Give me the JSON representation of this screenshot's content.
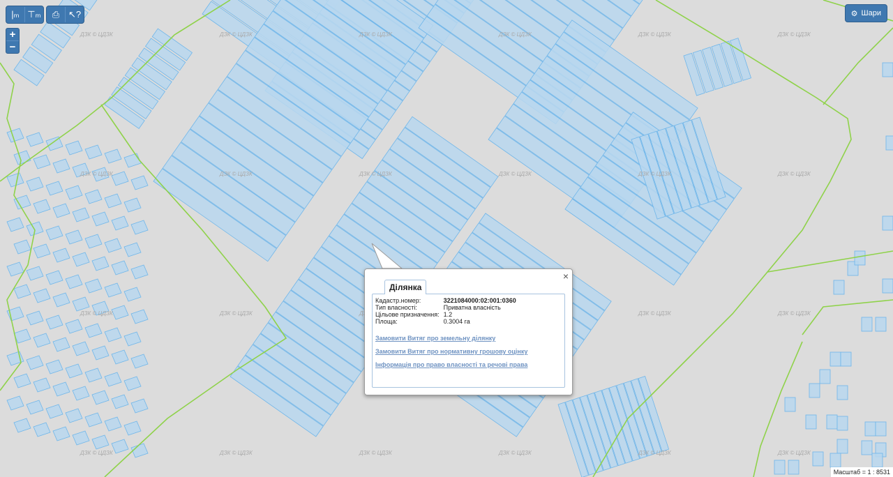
{
  "toolbar": {
    "tools": [
      {
        "name": "measure-length-icon",
        "glyph": "|ₘ"
      },
      {
        "name": "measure-area-icon",
        "glyph": "⊤ₘ²"
      },
      {
        "name": "print-icon",
        "glyph": "⎙"
      },
      {
        "name": "identify-icon",
        "glyph": "↖?"
      }
    ]
  },
  "zoom": {
    "in": "+",
    "out": "−"
  },
  "layers": {
    "label": "Шари",
    "icon": "gear-icon"
  },
  "watermark": "ДЗК © ЦДЗК",
  "popup": {
    "tab": "Ділянка",
    "close": "×",
    "fields": [
      {
        "label": "Кадастр.номер:",
        "value": "3221084000:02:001:0360"
      },
      {
        "label": "Тип власності:",
        "value": "Приватна власність"
      },
      {
        "label": "Цільове призначення:",
        "value": "1.2"
      },
      {
        "label": "Площа:",
        "value": "0.3004 га"
      }
    ],
    "links": [
      "Замовити Витяг про земельну ділянку",
      "Замовити Витяг про нормативну грошову оцінку",
      "Інформація про право власності та речові права"
    ]
  },
  "scale": "Масштаб = 1 : 8531",
  "colors": {
    "background": "#dcdcdc",
    "parcel_fill": "#b9d7ee",
    "parcel_stroke": "#6fb6ea",
    "boundary": "#8fd24a",
    "ui_blue": "#3f78b0"
  }
}
